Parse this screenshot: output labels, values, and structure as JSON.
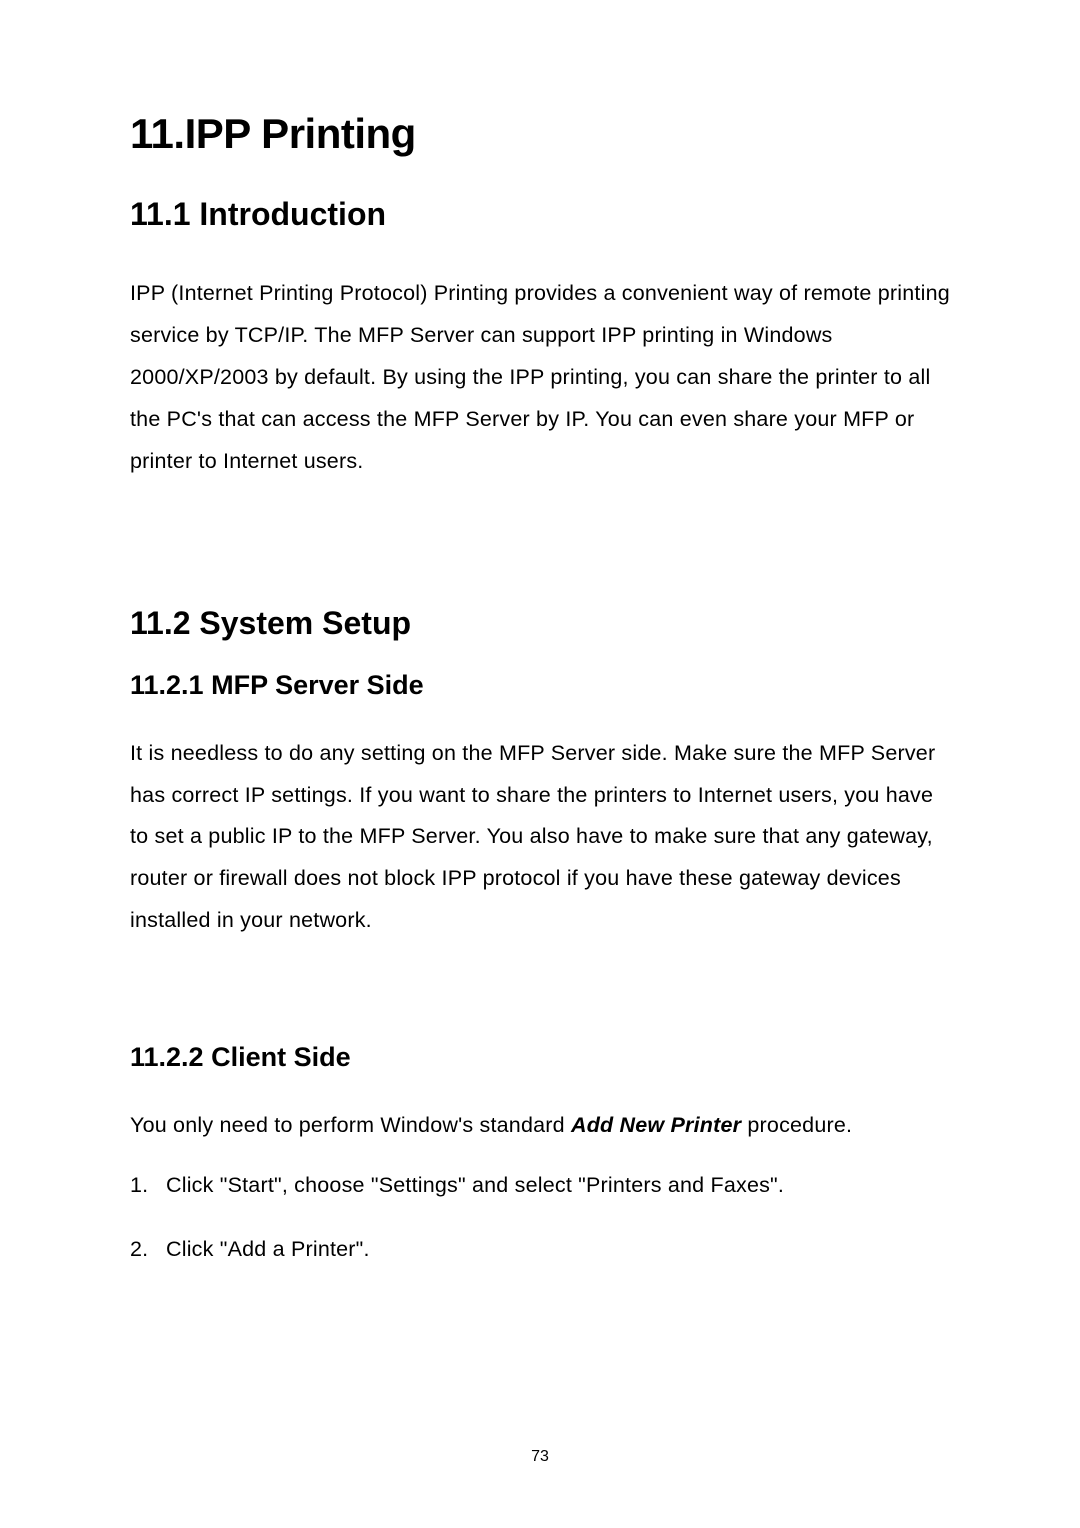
{
  "chapter": {
    "title": "11.IPP Printing"
  },
  "section1": {
    "title": "11.1  Introduction",
    "body": "IPP (Internet Printing Protocol) Printing provides a convenient way of remote printing service by TCP/IP. The MFP Server can support IPP printing in Windows 2000/XP/2003 by default. By using the IPP printing, you can share the printer to all the PC's that can access the MFP Server by IP. You can even share your MFP or printer to Internet users."
  },
  "section2": {
    "title": "11.2  System Setup"
  },
  "subsection1": {
    "title": "11.2.1  MFP Server Side",
    "body": "It is needless to do any setting on the MFP Server side. Make sure the MFP Server has correct IP settings. If you want to share the printers to Internet users, you have to set a public IP to the MFP Server. You also have to make sure that any gateway, router or firewall does not block IPP protocol if you have these gateway devices installed in your network."
  },
  "subsection2": {
    "title": "11.2.2  Client Side",
    "intro_prefix": "You only need to perform Window's standard ",
    "intro_bold": "Add New Printer",
    "intro_suffix": " procedure.",
    "step1_num": "1.",
    "step1_text": "Click \"Start\", choose \"Settings\" and select \"Printers and Faxes\".",
    "step2_num": "2.",
    "step2_text": "Click \"Add a Printer\"."
  },
  "page_number": "73"
}
